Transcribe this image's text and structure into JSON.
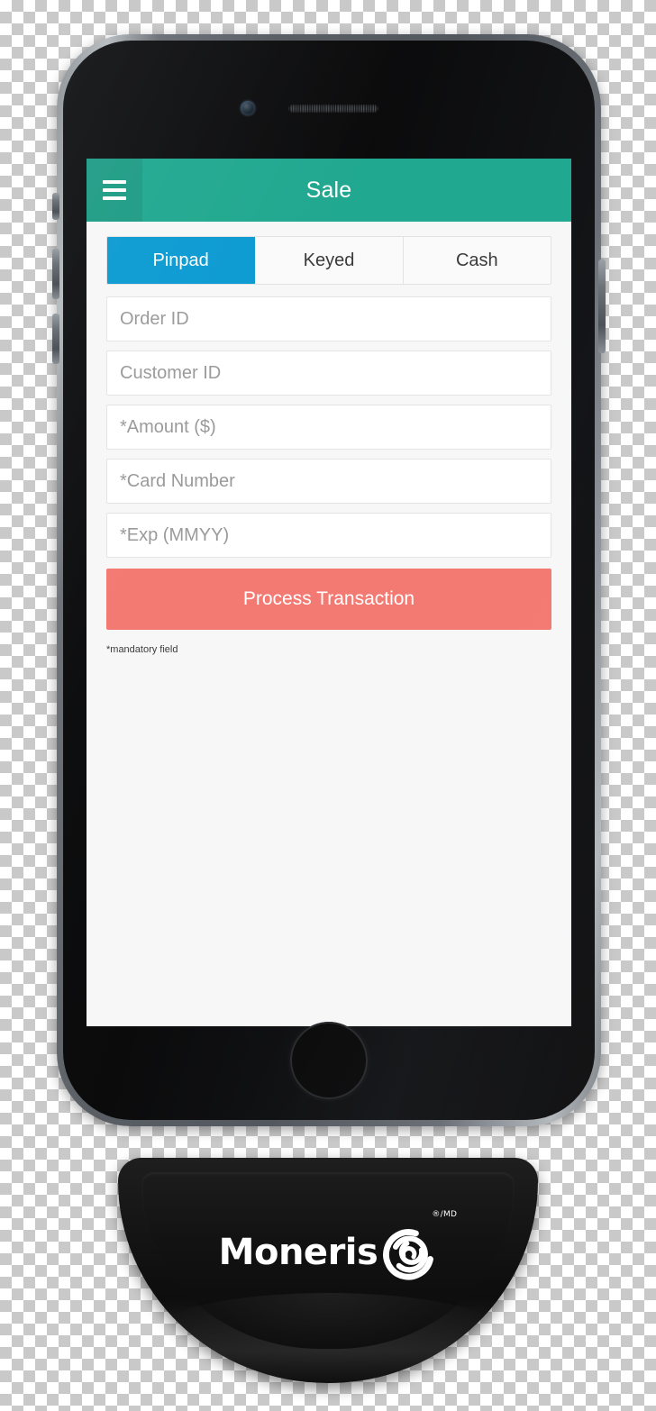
{
  "app": {
    "header": {
      "title": "Sale",
      "menu_icon": "hamburger-menu-icon",
      "background_color": "#21A890"
    },
    "tabs": [
      {
        "label": "Pinpad",
        "active": true,
        "active_color": "#0C9BD2"
      },
      {
        "label": "Keyed",
        "active": false
      },
      {
        "label": "Cash",
        "active": false
      }
    ],
    "form": {
      "fields": [
        {
          "placeholder": "Order ID",
          "value": "",
          "required": false
        },
        {
          "placeholder": "Customer ID",
          "value": "",
          "required": false
        },
        {
          "placeholder": "*Amount ($)",
          "value": "",
          "required": true
        },
        {
          "placeholder": "*Card Number",
          "value": "",
          "required": true
        },
        {
          "placeholder": "*Exp (MMYY)",
          "value": "",
          "required": true
        }
      ],
      "submit_label": "Process Transaction",
      "submit_color": "#F37A72",
      "mandatory_note": "*mandatory field"
    }
  },
  "device": {
    "camera_icon": "front-camera-icon",
    "speaker_icon": "earpiece-speaker-icon",
    "home_button_icon": "home-button-icon",
    "silence_switch_icon": "silence-switch-icon",
    "volume_up_icon": "volume-up-button-icon",
    "volume_down_icon": "volume-down-button-icon",
    "power_icon": "power-button-icon"
  },
  "dongle": {
    "brand": "Moneris",
    "trademark": "®/MD",
    "logo_icon": "moneris-swirl-logo-icon"
  }
}
